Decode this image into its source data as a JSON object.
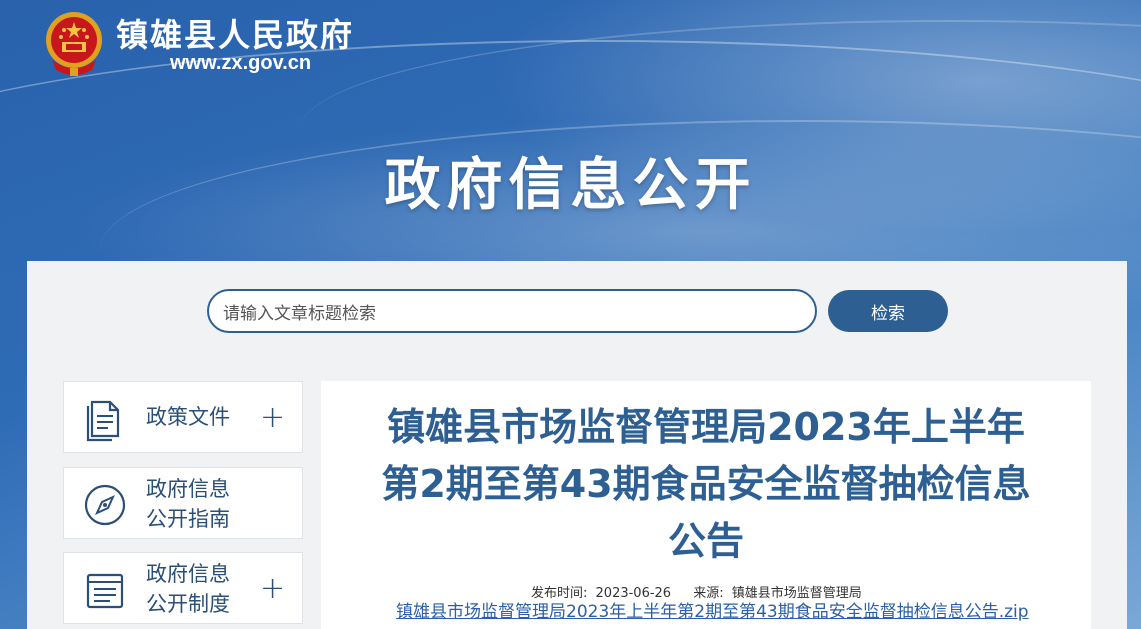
{
  "header": {
    "site_name": "镇雄县人民政府",
    "site_url": "www.zx.gov.cn",
    "banner_title": "政府信息公开"
  },
  "search": {
    "placeholder": "请输入文章标题检索",
    "button_label": "检索"
  },
  "sidebar": {
    "items": [
      {
        "label_line1": "政策文件",
        "label_line2": "",
        "icon": "document-icon",
        "expandable": true
      },
      {
        "label_line1": "政府信息",
        "label_line2": "公开指南",
        "icon": "compass-icon",
        "expandable": false
      },
      {
        "label_line1": "政府信息",
        "label_line2": "公开制度",
        "icon": "list-document-icon",
        "expandable": true
      }
    ]
  },
  "article": {
    "title_line1": "镇雄县市场监督管理局2023年上半年",
    "title_line2": "第2期至第43期食品安全监督抽检信息",
    "title_line3": "公告",
    "publish_label": "发布时间:",
    "publish_date": "2023-06-26",
    "source_label": "来源:",
    "source": "镇雄县市场监督管理局",
    "attachment": "镇雄县市场监督管理局2023年上半年第2期至第43期食品安全监督抽检信息公告.zip"
  },
  "colors": {
    "primary": "#2d5f92",
    "banner": "#2f67ad",
    "link": "#2b5fa8"
  }
}
